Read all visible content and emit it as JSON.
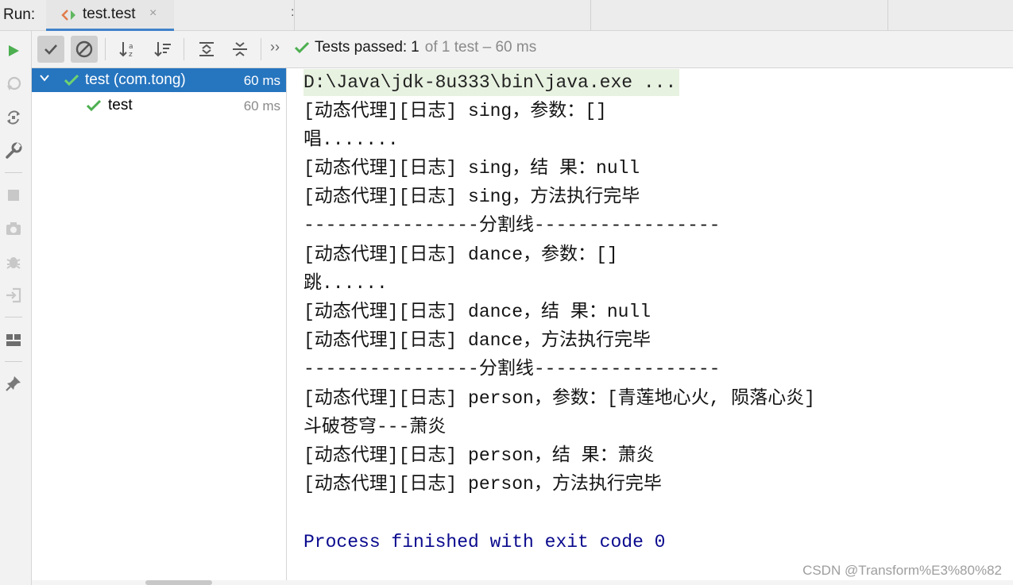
{
  "run_bar": {
    "label": "Run:",
    "tab_title": "test.test",
    "tab_close": "×",
    "more_glyph": ":"
  },
  "left_toolbar": {
    "icons": [
      "rerun-icon",
      "rerun-failed-icon",
      "toggle-auto-test-icon",
      "settings-wrench-icon",
      "stop-icon",
      "screenshot-camera-icon",
      "debug-bug-icon",
      "exit-icon",
      "layout-icon",
      "pin-icon"
    ]
  },
  "test_toolbar": {
    "more_glyph": "››",
    "status_label": "Tests passed:",
    "passed_count": "1",
    "status_rest": "of 1 test – 60 ms"
  },
  "test_tree": [
    {
      "label": "test (com.tong)",
      "time": "60 ms",
      "expanded": true,
      "selected": true
    },
    {
      "label": "test",
      "time": "60 ms",
      "expanded": false,
      "selected": false
    }
  ],
  "console": {
    "command": "D:\\Java\\jdk-8u333\\bin\\java.exe ...",
    "lines": [
      "[动态代理][日志] sing，参数：[]",
      "唱.......",
      "[动态代理][日志] sing，结 果：null",
      "[动态代理][日志] sing，方法执行完毕",
      "----------------分割线-----------------",
      "[动态代理][日志] dance，参数：[]",
      "跳......",
      "[动态代理][日志] dance，结 果：null",
      "[动态代理][日志] dance，方法执行完毕",
      "----------------分割线-----------------",
      "[动态代理][日志] person，参数：[青莲地心火, 陨落心炎]",
      "斗破苍穹---萧炎",
      "[动态代理][日志] person，结 果：萧炎",
      "[动态代理][日志] person，方法执行完毕"
    ],
    "exit_message": "Process finished with exit code 0"
  },
  "watermark": "CSDN @Transform%E3%80%82",
  "colors": {
    "accent_blue": "#2675bf",
    "pass_green": "#4caf50",
    "exit_text": "#0a0a8e",
    "command_bg": "#e8f2e1"
  }
}
